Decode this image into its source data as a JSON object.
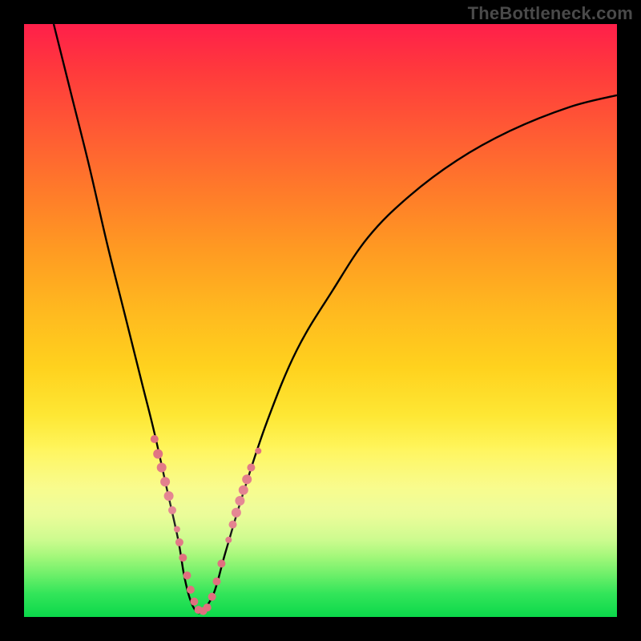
{
  "watermark": "TheBottleneck.com",
  "colors": {
    "frame": "#000000",
    "curve": "#000000",
    "dot": "#e0707f",
    "watermark_text": "#4a4a4a"
  },
  "chart_data": {
    "type": "line",
    "title": "",
    "xlabel": "",
    "ylabel": "",
    "xlim": [
      0,
      100
    ],
    "ylim": [
      0,
      100
    ],
    "note": "V-shaped bottleneck curve. x is a normalized horizontal axis (0 left, 100 right). y is bottleneck percent (0 bottom/green = no bottleneck, 100 top/red = severe). Values are estimated from the image since no axis ticks are shown.",
    "series": [
      {
        "name": "bottleneck-curve",
        "x": [
          5,
          8,
          11,
          14,
          17,
          20,
          22,
          24,
          26,
          27,
          28,
          29,
          30,
          32,
          34,
          37,
          41,
          46,
          52,
          58,
          65,
          73,
          82,
          92,
          100
        ],
        "y": [
          100,
          88,
          76,
          63,
          51,
          39,
          31,
          22,
          13,
          7,
          3,
          1,
          1,
          4,
          11,
          21,
          33,
          45,
          55,
          64,
          71,
          77,
          82,
          86,
          88
        ]
      }
    ],
    "minimum": {
      "x": 29.5,
      "y": 0.5
    },
    "dots": {
      "note": "Salmon sample dots along the lower part of the V; estimated positions.",
      "points": [
        {
          "x": 22.0,
          "y": 30.0,
          "r": 5
        },
        {
          "x": 22.6,
          "y": 27.5,
          "r": 6
        },
        {
          "x": 23.2,
          "y": 25.2,
          "r": 6
        },
        {
          "x": 23.8,
          "y": 22.8,
          "r": 6
        },
        {
          "x": 24.4,
          "y": 20.4,
          "r": 6
        },
        {
          "x": 25.0,
          "y": 18.0,
          "r": 5
        },
        {
          "x": 25.8,
          "y": 14.8,
          "r": 4
        },
        {
          "x": 26.2,
          "y": 12.6,
          "r": 5
        },
        {
          "x": 26.8,
          "y": 10.0,
          "r": 5
        },
        {
          "x": 27.5,
          "y": 7.0,
          "r": 5
        },
        {
          "x": 28.1,
          "y": 4.6,
          "r": 5
        },
        {
          "x": 28.7,
          "y": 2.6,
          "r": 5
        },
        {
          "x": 29.4,
          "y": 1.2,
          "r": 5
        },
        {
          "x": 30.2,
          "y": 1.0,
          "r": 5
        },
        {
          "x": 30.9,
          "y": 1.6,
          "r": 5
        },
        {
          "x": 31.7,
          "y": 3.4,
          "r": 5
        },
        {
          "x": 32.5,
          "y": 6.0,
          "r": 5
        },
        {
          "x": 33.3,
          "y": 9.0,
          "r": 5
        },
        {
          "x": 34.5,
          "y": 13.0,
          "r": 4
        },
        {
          "x": 35.2,
          "y": 15.6,
          "r": 5
        },
        {
          "x": 35.8,
          "y": 17.6,
          "r": 6
        },
        {
          "x": 36.4,
          "y": 19.6,
          "r": 6
        },
        {
          "x": 37.0,
          "y": 21.4,
          "r": 6
        },
        {
          "x": 37.6,
          "y": 23.2,
          "r": 6
        },
        {
          "x": 38.3,
          "y": 25.2,
          "r": 5
        },
        {
          "x": 39.5,
          "y": 28.0,
          "r": 4
        }
      ]
    }
  }
}
